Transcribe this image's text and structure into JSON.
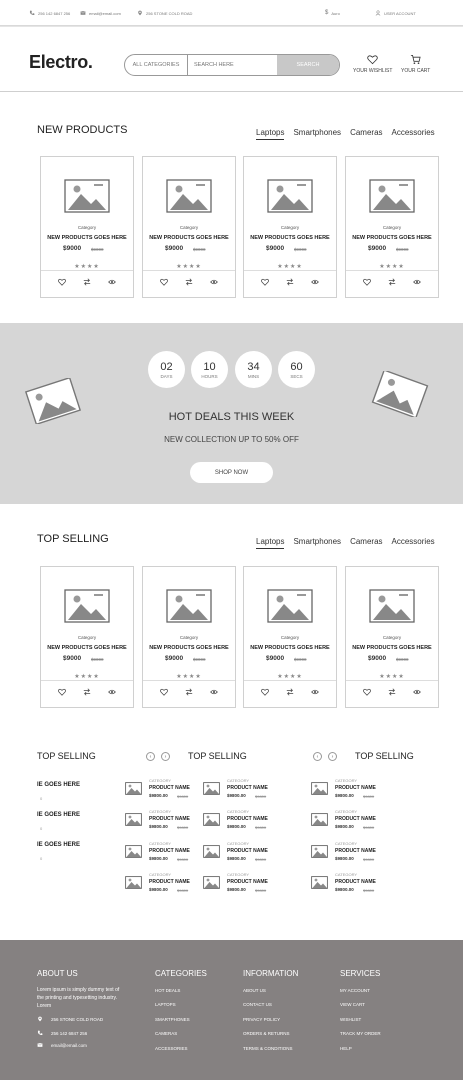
{
  "topbar": {
    "phone": "256 142 6847 256",
    "email": "email@email.com",
    "address": "256 STONE COLD ROAD",
    "currency": "$",
    "currency_label": "Auro",
    "account": "USER ACCOUNT"
  },
  "header": {
    "logo": "Electro.",
    "search": {
      "category": "ALL CATEGORIES",
      "placeholder": "SEARCH HERE",
      "button": "SEARCH"
    },
    "wishlist": "YOUR WISHLIST",
    "cart": "YOUR CART"
  },
  "new_products": {
    "title": "NEW PRODUCTS",
    "tabs": [
      "Laptops",
      "Smartphones",
      "Cameras",
      "Accessories"
    ],
    "products": [
      {
        "category": "Category",
        "name": "NEW PRODUCTS GOES HERE",
        "price": "$9000",
        "old_price": "$9000",
        "rating": 4
      },
      {
        "category": "Category",
        "name": "NEW PRODUCTS GOES HERE",
        "price": "$9000",
        "old_price": "$9000",
        "rating": 4
      },
      {
        "category": "Category",
        "name": "NEW PRODUCTS GOES HERE",
        "price": "$9000",
        "old_price": "$9000",
        "rating": 4
      },
      {
        "category": "Category",
        "name": "NEW PRODUCTS GOES HERE",
        "price": "$9000",
        "old_price": "$9000",
        "rating": 4
      }
    ]
  },
  "deals": {
    "countdown": [
      {
        "value": "02",
        "label": "DAYS"
      },
      {
        "value": "10",
        "label": "HOURS"
      },
      {
        "value": "34",
        "label": "MINS"
      },
      {
        "value": "60",
        "label": "SECS"
      }
    ],
    "title": "HOT DEALS THIS WEEK",
    "subtitle": "NEW COLLECTION UP TO 50% OFF",
    "button": "SHOP NOW"
  },
  "top_selling": {
    "title": "TOP SELLING",
    "tabs": [
      "Laptops",
      "Smartphones",
      "Cameras",
      "Accessories"
    ],
    "products": [
      {
        "category": "Category",
        "name": "NEW PRODUCTS GOES HERE",
        "price": "$9000",
        "old_price": "$9000",
        "rating": 4
      },
      {
        "category": "Category",
        "name": "NEW PRODUCTS GOES HERE",
        "price": "$9000",
        "old_price": "$9000",
        "rating": 4
      },
      {
        "category": "Category",
        "name": "NEW PRODUCTS GOES HERE",
        "price": "$9000",
        "old_price": "$9000",
        "rating": 4
      },
      {
        "category": "Category",
        "name": "NEW PRODUCTS GOES HERE",
        "price": "$9000",
        "old_price": "$9000",
        "rating": 4
      }
    ]
  },
  "lists": {
    "col1_title": "TOP SELLING",
    "col2_title": "TOP SELLING",
    "col3_title": "TOP SELLING",
    "arrow_prev": "‹",
    "arrow_next": "›",
    "partial_items": [
      {
        "name": "IE GOES HERE",
        "sub": "0"
      },
      {
        "name": "IE GOES HERE",
        "sub": "0"
      },
      {
        "name": "IE GOES HERE",
        "sub": "0"
      }
    ],
    "item": {
      "category": "CATEGORY",
      "name": "PRODUCT NAME",
      "price": "$9800.00",
      "old_price": "$9800"
    }
  },
  "footer": {
    "about": {
      "title": "ABOUT US",
      "text": "Lorem ipsum is simply dummy text of the printing and typesetting industry. Lorem",
      "address": "256 STONE COLD ROAD",
      "phone": "256 142 6847 256",
      "email": "email@email.com"
    },
    "categories": {
      "title": "CATEGORIES",
      "links": [
        "HOT DEALS",
        "LAPTOPS",
        "SMARTPHONES",
        "CAMERAS",
        "ACCESSORIES"
      ]
    },
    "information": {
      "title": "INFORMATION",
      "links": [
        "ABOUT US",
        "CONTACT US",
        "PRIVACY POLICY",
        "ORDERS & RETURNS",
        "TERMS & CONDITIONS"
      ]
    },
    "services": {
      "title": "SERVICES",
      "links": [
        "MY ACCOUNT",
        "VIEW CART",
        "WISHLIST",
        "TRACK MY ORDER",
        "HELP"
      ]
    }
  }
}
